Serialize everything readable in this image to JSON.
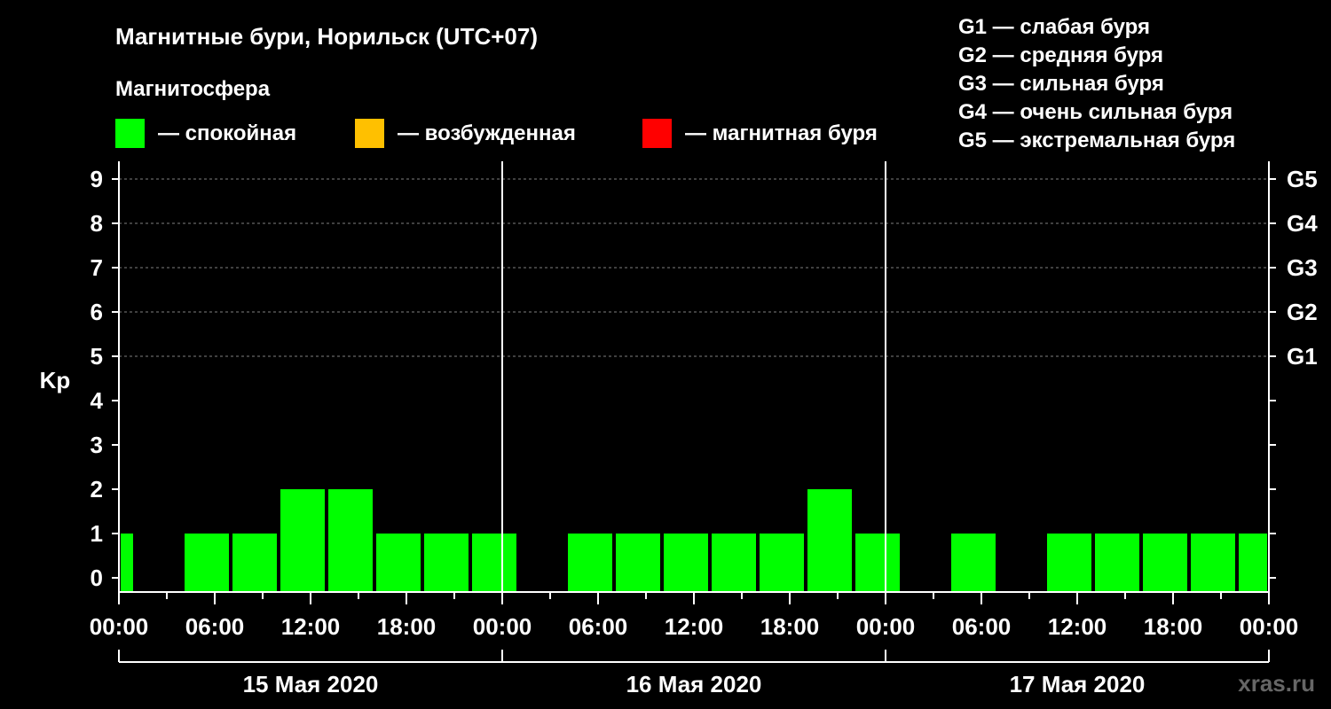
{
  "chart_data": {
    "type": "bar",
    "title": "Магнитные бури, Норильск (UTC+07)",
    "subtitle": "Магнитосфера",
    "ylabel": "Kp",
    "ylim": [
      0,
      9
    ],
    "yticks": [
      "0",
      "1",
      "2",
      "3",
      "4",
      "5",
      "6",
      "7",
      "8",
      "9"
    ],
    "right_axis_labels": [
      {
        "y": 5,
        "label": "G1"
      },
      {
        "y": 6,
        "label": "G2"
      },
      {
        "y": 7,
        "label": "G3"
      },
      {
        "y": 8,
        "label": "G4"
      },
      {
        "y": 9,
        "label": "G5"
      }
    ],
    "xlim_hours": [
      0,
      72
    ],
    "xticks": [
      {
        "hour": 0,
        "label": "00:00"
      },
      {
        "hour": 6,
        "label": "06:00"
      },
      {
        "hour": 12,
        "label": "12:00"
      },
      {
        "hour": 18,
        "label": "18:00"
      },
      {
        "hour": 24,
        "label": "00:00"
      },
      {
        "hour": 30,
        "label": "06:00"
      },
      {
        "hour": 36,
        "label": "12:00"
      },
      {
        "hour": 42,
        "label": "18:00"
      },
      {
        "hour": 48,
        "label": "00:00"
      },
      {
        "hour": 54,
        "label": "06:00"
      },
      {
        "hour": 60,
        "label": "12:00"
      },
      {
        "hour": 66,
        "label": "18:00"
      },
      {
        "hour": 72,
        "label": "00:00"
      }
    ],
    "days": [
      {
        "label": "15 Мая 2020",
        "start_hour": 0,
        "end_hour": 24
      },
      {
        "label": "16 Мая 2020",
        "start_hour": 24,
        "end_hour": 48
      },
      {
        "label": "17 Мая 2020",
        "start_hour": 48,
        "end_hour": 72
      }
    ],
    "day_separators_hours": [
      24,
      48
    ],
    "grid": "dashed at Kp 5–9",
    "bars": [
      {
        "start_hour": 0,
        "end_hour": 1,
        "kp": 1,
        "status": "calm"
      },
      {
        "start_hour": 4,
        "end_hour": 7,
        "kp": 1,
        "status": "calm"
      },
      {
        "start_hour": 7,
        "end_hour": 10,
        "kp": 1,
        "status": "calm"
      },
      {
        "start_hour": 10,
        "end_hour": 13,
        "kp": 2,
        "status": "calm"
      },
      {
        "start_hour": 13,
        "end_hour": 16,
        "kp": 2,
        "status": "calm"
      },
      {
        "start_hour": 16,
        "end_hour": 19,
        "kp": 1,
        "status": "calm"
      },
      {
        "start_hour": 19,
        "end_hour": 22,
        "kp": 1,
        "status": "calm"
      },
      {
        "start_hour": 22,
        "end_hour": 25,
        "kp": 1,
        "status": "calm"
      },
      {
        "start_hour": 28,
        "end_hour": 31,
        "kp": 1,
        "status": "calm"
      },
      {
        "start_hour": 31,
        "end_hour": 34,
        "kp": 1,
        "status": "calm"
      },
      {
        "start_hour": 34,
        "end_hour": 37,
        "kp": 1,
        "status": "calm"
      },
      {
        "start_hour": 37,
        "end_hour": 40,
        "kp": 1,
        "status": "calm"
      },
      {
        "start_hour": 40,
        "end_hour": 43,
        "kp": 1,
        "status": "calm"
      },
      {
        "start_hour": 43,
        "end_hour": 46,
        "kp": 2,
        "status": "calm"
      },
      {
        "start_hour": 46,
        "end_hour": 49,
        "kp": 1,
        "status": "calm"
      },
      {
        "start_hour": 52,
        "end_hour": 55,
        "kp": 1,
        "status": "calm"
      },
      {
        "start_hour": 58,
        "end_hour": 61,
        "kp": 1,
        "status": "calm"
      },
      {
        "start_hour": 61,
        "end_hour": 64,
        "kp": 1,
        "status": "calm"
      },
      {
        "start_hour": 64,
        "end_hour": 67,
        "kp": 1,
        "status": "calm"
      },
      {
        "start_hour": 67,
        "end_hour": 70,
        "kp": 1,
        "status": "calm"
      },
      {
        "start_hour": 70,
        "end_hour": 72,
        "kp": 1,
        "status": "calm"
      }
    ],
    "legend": [
      {
        "status": "calm",
        "label": "— спокойная",
        "color": "#00ff00"
      },
      {
        "status": "excited",
        "label": "— возбужденная",
        "color": "#ffc000"
      },
      {
        "status": "storm",
        "label": "— магнитная буря",
        "color": "#ff0000"
      }
    ],
    "g_legend": [
      "G1 — слабая буря",
      "G2 — средняя буря",
      "G3 — сильная буря",
      "G4 — очень сильная буря",
      "G5 — экстремальная буря"
    ],
    "watermark": "xras.ru",
    "colors": {
      "background": "#000000",
      "axis": "#ffffff",
      "grid": "#808080",
      "watermark": "#666666"
    }
  }
}
